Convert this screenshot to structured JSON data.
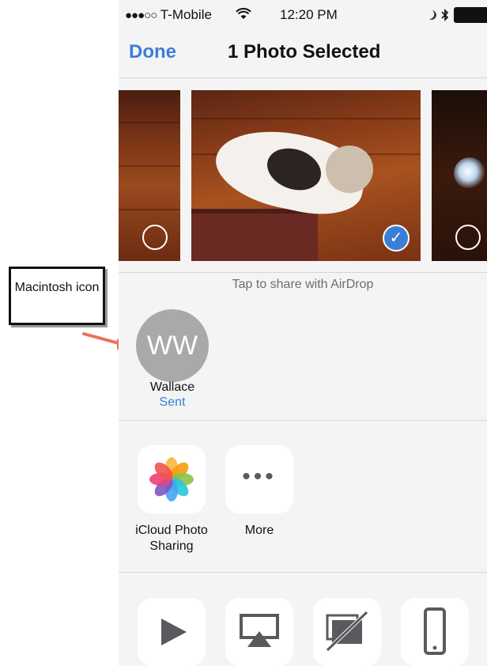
{
  "status_bar": {
    "signal": "●●●○○",
    "carrier": "T-Mobile",
    "time": "12:20 PM",
    "icons": [
      "wifi-icon",
      "moon-icon",
      "bluetooth-icon",
      "battery-icon"
    ]
  },
  "nav": {
    "done_label": "Done",
    "title": "1 Photo Selected"
  },
  "photos": [
    {
      "selected": false
    },
    {
      "selected": true
    },
    {
      "selected": false
    }
  ],
  "airdrop": {
    "hint": "Tap to share with AirDrop",
    "contact": {
      "initials": "WW",
      "name": "Wallace",
      "status": "Sent"
    }
  },
  "share_apps": [
    {
      "label": "iCloud Photo Sharing",
      "icon": "photos-icon"
    },
    {
      "label": "More",
      "icon": "more-icon"
    }
  ],
  "actions": [
    {
      "icon": "slideshow-icon"
    },
    {
      "icon": "airplay-icon"
    },
    {
      "icon": "hide-icon"
    },
    {
      "icon": "device-icon"
    }
  ],
  "annotation": {
    "text": "Macintosh icon"
  },
  "colors": {
    "accent": "#3a7ed7",
    "callout_arrow": "#e8735a",
    "avatar": "#a9a9ab"
  }
}
